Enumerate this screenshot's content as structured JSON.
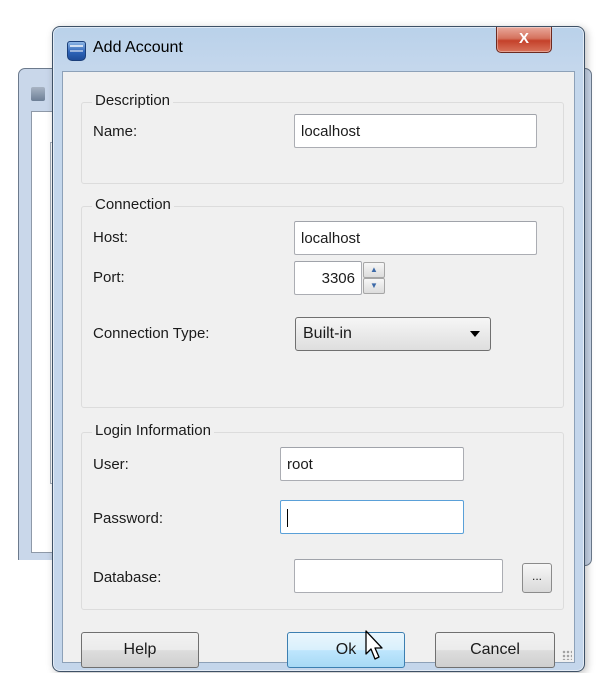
{
  "dialog": {
    "title": "Add Account",
    "close_label": "X"
  },
  "description": {
    "legend": "Description",
    "name_label": "Name:",
    "name_value": "localhost"
  },
  "connection": {
    "legend": "Connection",
    "host_label": "Host:",
    "host_value": "localhost",
    "port_label": "Port:",
    "port_value": "3306",
    "type_label": "Connection Type:",
    "type_value": "Built-in"
  },
  "login": {
    "legend": "Login Information",
    "user_label": "User:",
    "user_value": "root",
    "password_label": "Password:",
    "password_value": "",
    "database_label": "Database:",
    "database_value": "",
    "browse_label": "..."
  },
  "buttons": {
    "help": "Help",
    "ok": "Ok",
    "cancel": "Cancel"
  }
}
